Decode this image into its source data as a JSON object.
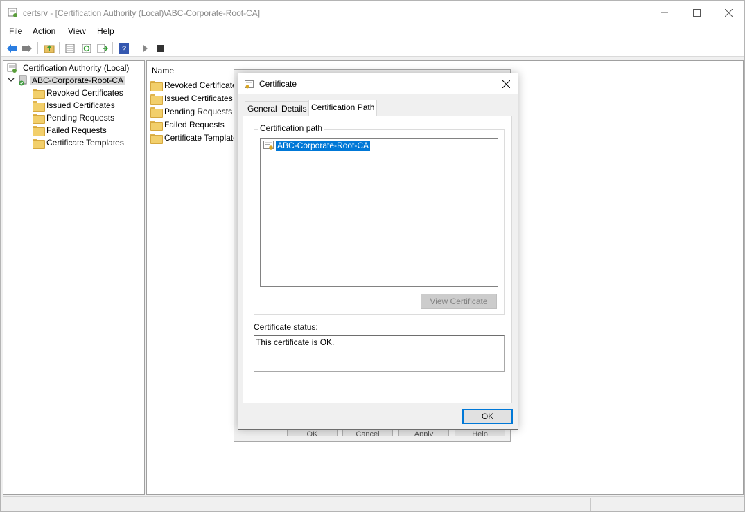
{
  "window": {
    "title": "certsrv - [Certification Authority (Local)\\ABC-Corporate-Root-CA]"
  },
  "menu": [
    "File",
    "Action",
    "View",
    "Help"
  ],
  "toolbar": {
    "icons": [
      "back-arrow-icon",
      "forward-arrow-icon",
      "up-folder-icon",
      "properties-icon",
      "refresh-icon",
      "export-list-icon",
      "help-icon",
      "start-service-icon",
      "stop-service-icon"
    ]
  },
  "tree": {
    "root": "Certification Authority (Local)",
    "ca": "ABC-Corporate-Root-CA",
    "folders": [
      "Revoked Certificates",
      "Issued Certificates",
      "Pending Requests",
      "Failed Requests",
      "Certificate Templates"
    ]
  },
  "list": {
    "column_name": "Name",
    "items": [
      "Revoked Certificates",
      "Issued Certificates",
      "Pending Requests",
      "Failed Requests",
      "Certificate Templates"
    ]
  },
  "bg_dialog": {
    "buttons": [
      "OK",
      "Cancel",
      "Apply",
      "Help"
    ]
  },
  "dialog": {
    "title": "Certificate",
    "tabs": [
      "General",
      "Details",
      "Certification Path"
    ],
    "active_tab": "Certification Path",
    "group_label": "Certification path",
    "path_item": "ABC-Corporate-Root-CA",
    "view_button": "View Certificate",
    "status_label": "Certificate status:",
    "status_text": "This certificate is OK.",
    "ok_button": "OK"
  },
  "colors": {
    "selection": "#0078d7",
    "folder": "#f2cf6b",
    "window_bg": "#f0f0f0"
  }
}
